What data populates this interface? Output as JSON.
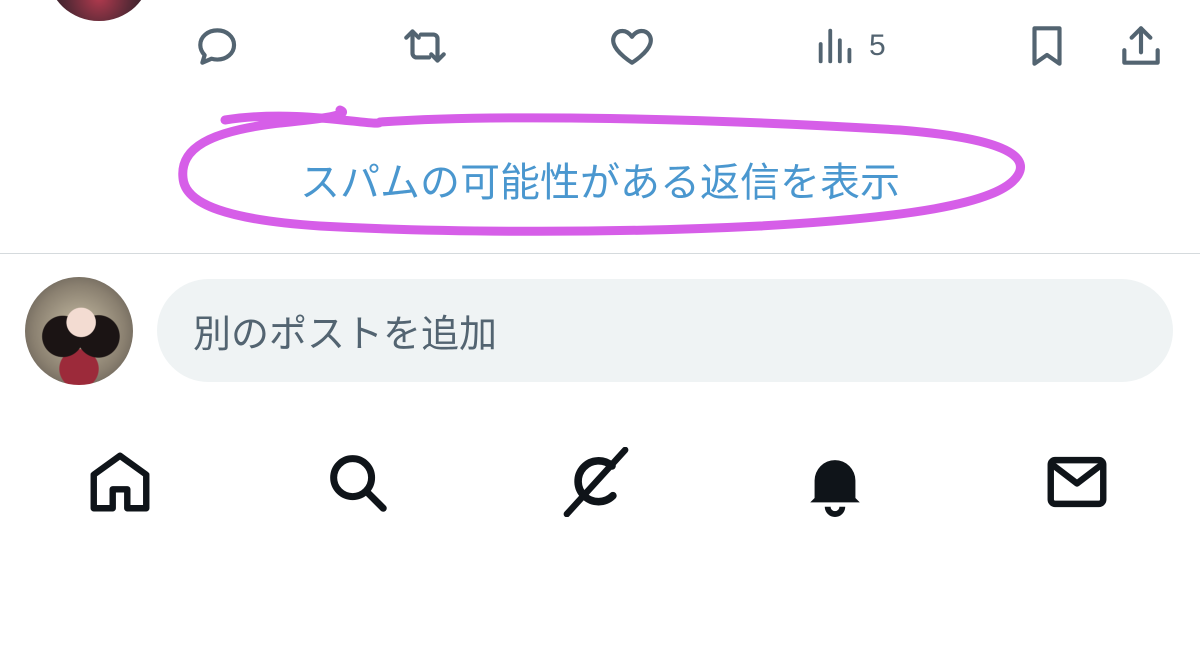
{
  "tweet_actions": {
    "reply_icon": "speech-bubble-icon",
    "retweet_icon": "retweet-icon",
    "like_icon": "heart-icon",
    "views_icon": "bar-chart-icon",
    "views_count": "5",
    "bookmark_icon": "bookmark-icon",
    "share_icon": "share-icon"
  },
  "spam_replies": {
    "label": "スパムの可能性がある返信を表示",
    "link_color": "#4a97cf",
    "annotation_color": "#d65ee8"
  },
  "compose": {
    "placeholder": "別のポストを追加"
  },
  "bottom_nav": {
    "items": [
      "home-icon",
      "search-icon",
      "grok-icon",
      "bell-icon",
      "mail-icon"
    ],
    "icon_color": "#0f1419"
  },
  "colors": {
    "secondary_text": "#536471",
    "input_bg": "#eff3f4",
    "divider": "#d5dadd"
  }
}
